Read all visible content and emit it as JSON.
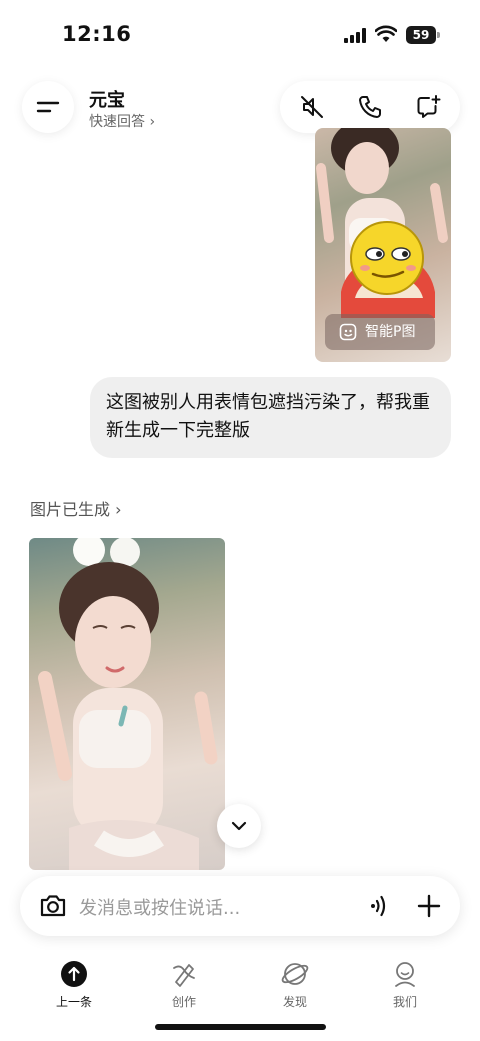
{
  "status_bar": {
    "time": "12:16",
    "battery": "59"
  },
  "header": {
    "title": "元宝",
    "subtitle": "快速回答 ›",
    "icons": [
      "mute-icon",
      "phone-icon",
      "new-chat-icon"
    ]
  },
  "messages": {
    "sent_image_chip": "智能P图",
    "user_text": "这图被别人用表情包遮挡污染了，帮我重新生成一下完整版",
    "generated_label": "图片已生成 ›"
  },
  "composer": {
    "placeholder": "发消息或按住说话..."
  },
  "tabs": [
    {
      "label": "上一条",
      "icon": "up-arrow-icon",
      "active": true
    },
    {
      "label": "创作",
      "icon": "create-icon",
      "active": false
    },
    {
      "label": "发现",
      "icon": "planet-icon",
      "active": false
    },
    {
      "label": "我们",
      "icon": "profile-icon",
      "active": false
    }
  ],
  "colors": {
    "accent": "#111111",
    "bubble": "#efefef",
    "muted": "#9a9a9a"
  }
}
